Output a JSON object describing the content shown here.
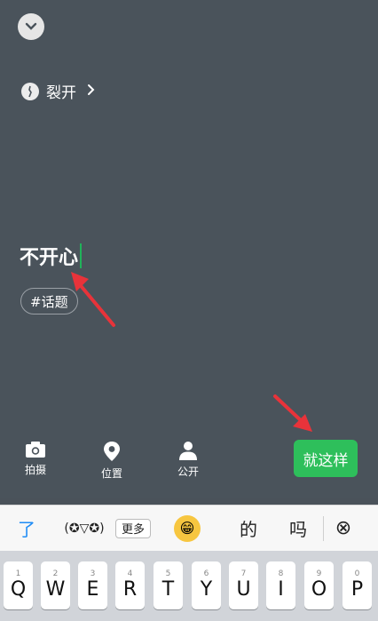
{
  "mood": {
    "label": "裂开",
    "chevron": "›"
  },
  "post": {
    "text": "不开心"
  },
  "topic": {
    "label": "#话题"
  },
  "toolbar": {
    "photo_label": "拍摄",
    "location_label": "位置",
    "visibility_label": "公开",
    "submit_label": "就这样"
  },
  "suggestions": {
    "first": "了",
    "kaomoji": "(✪▽✪)",
    "more": "更多",
    "word1": "的",
    "word2": "吗",
    "close": "⊗"
  },
  "keyboard": {
    "keys": [
      {
        "num": "1",
        "letter": "Q"
      },
      {
        "num": "2",
        "letter": "W"
      },
      {
        "num": "3",
        "letter": "E"
      },
      {
        "num": "4",
        "letter": "R"
      },
      {
        "num": "5",
        "letter": "T"
      },
      {
        "num": "6",
        "letter": "Y"
      },
      {
        "num": "7",
        "letter": "U"
      },
      {
        "num": "8",
        "letter": "I"
      },
      {
        "num": "9",
        "letter": "O"
      },
      {
        "num": "0",
        "letter": "P"
      }
    ]
  },
  "colors": {
    "background": "#4a535b",
    "accent_green": "#2ebf5b",
    "annotation_red": "#e8333a",
    "suggestion_blue": "#1f8cf5"
  },
  "icons": {
    "collapse": "chevron-down-icon",
    "mood": "mood-icon",
    "photo": "camera-icon",
    "location": "location-pin-icon",
    "visibility": "person-icon",
    "emoji": "grinning-face-icon",
    "close": "close-circle-icon"
  }
}
